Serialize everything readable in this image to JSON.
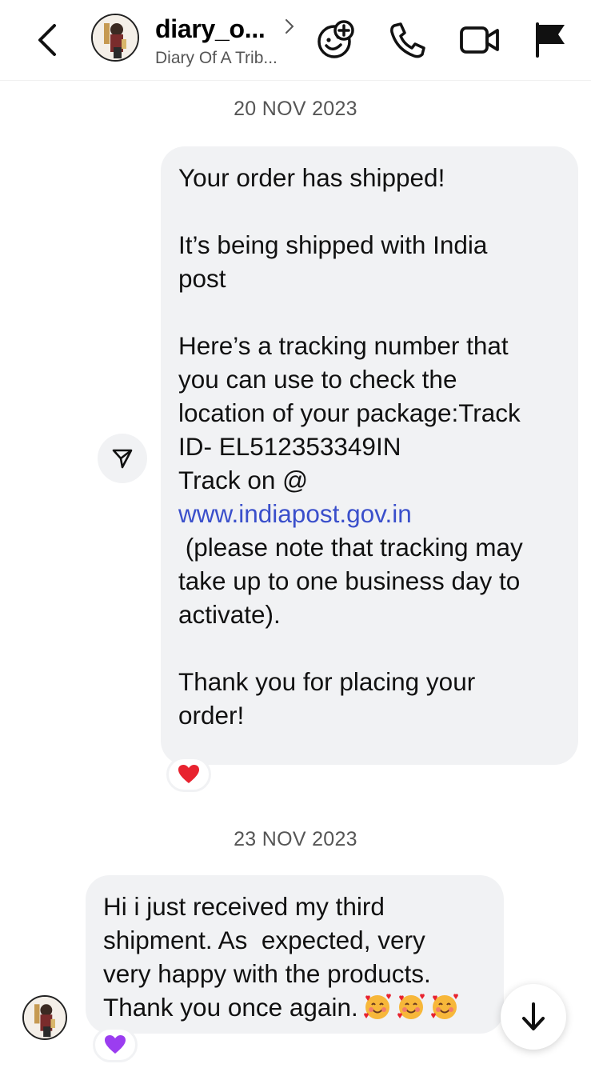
{
  "header": {
    "username": "diary_o...",
    "display_name": "Diary Of A Trib...",
    "icons": [
      "back-chevron-icon",
      "avatar",
      "chevron-right-icon",
      "add-emoji-icon",
      "phone-icon",
      "video-camera-icon",
      "flag-icon"
    ]
  },
  "thread": {
    "date_1": "20 NOV 2023",
    "outgoing_message": {
      "text_lines": [
        "Your order has shipped!",
        "",
        "It’s being shipped with India",
        "post",
        "",
        "Here’s a tracking number that",
        "you can use to check the",
        "location of your package:Track",
        "ID- EL512353349IN",
        "Track on @"
      ],
      "link": "www.indiapost.gov.in",
      "text_after_link": [
        " (please note that tracking may",
        "take up to one business day to",
        "activate).",
        "",
        "Thank you for placing your",
        "order!"
      ],
      "reaction": "❤️",
      "share_icon": "share-send-icon"
    },
    "date_2": "23 NOV 2023",
    "incoming_message": {
      "text_lines": [
        "Hi i just received my third",
        "shipment. As  expected, very",
        "very happy with the products.",
        "Thank you once again."
      ],
      "emoji_icons": [
        "smiling-face-with-hearts-icon",
        "smiling-face-with-hearts-icon",
        "smiling-face-with-hearts-icon"
      ],
      "reaction": "💜"
    },
    "scroll_down_icon": "arrow-down-icon"
  },
  "colors": {
    "bubble": "#f1f2f4",
    "link": "#3a4fcb",
    "heart_red": "#e8232f",
    "heart_purple": "#9b3df0"
  }
}
